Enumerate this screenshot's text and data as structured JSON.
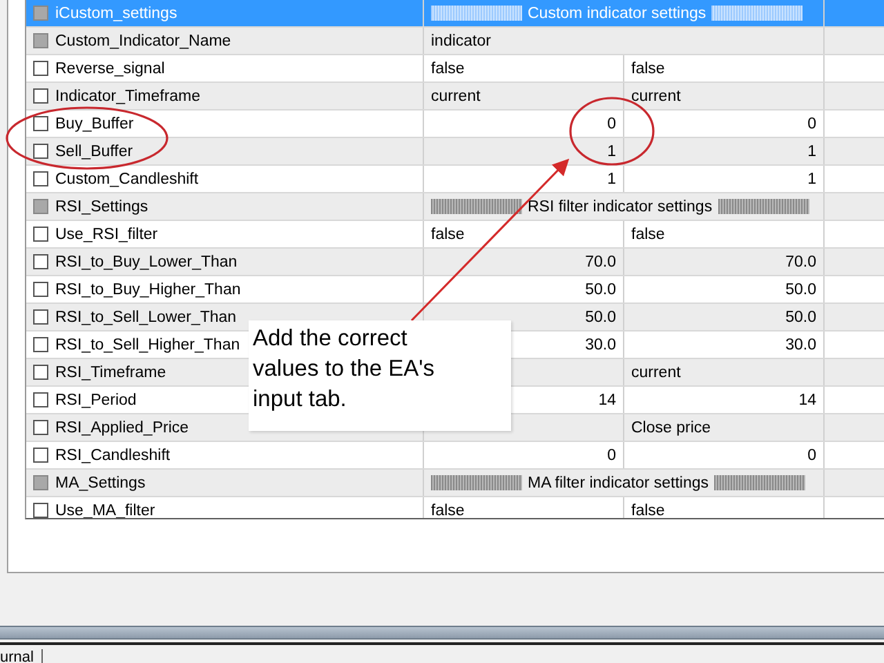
{
  "inputs": {
    "rows": [
      {
        "kind": "group",
        "name": "iCustom_settings",
        "value": "Custom indicator settings",
        "disabled": true,
        "selected": true
      },
      {
        "kind": "string",
        "name": "Custom_Indicator_Name",
        "value": "indicator",
        "disabled": true,
        "selected": false
      },
      {
        "kind": "text",
        "name": "Reverse_signal",
        "value": "false",
        "start": "false",
        "disabled": false,
        "selected": false
      },
      {
        "kind": "text",
        "name": "Indicator_Timeframe",
        "value": "current",
        "start": "current",
        "disabled": false,
        "selected": false
      },
      {
        "kind": "number",
        "name": "Buy_Buffer",
        "value": "0",
        "start": "0",
        "disabled": false,
        "selected": false
      },
      {
        "kind": "number",
        "name": "Sell_Buffer",
        "value": "1",
        "start": "1",
        "disabled": false,
        "selected": false
      },
      {
        "kind": "number",
        "name": "Custom_Candleshift",
        "value": "1",
        "start": "1",
        "disabled": false,
        "selected": false
      },
      {
        "kind": "group",
        "name": "RSI_Settings",
        "value": "RSI filter indicator settings",
        "disabled": true,
        "selected": false
      },
      {
        "kind": "text",
        "name": "Use_RSI_filter",
        "value": "false",
        "start": "false",
        "disabled": false,
        "selected": false
      },
      {
        "kind": "number",
        "name": "RSI_to_Buy_Lower_Than",
        "value": "70.0",
        "start": "70.0",
        "disabled": false,
        "selected": false
      },
      {
        "kind": "number",
        "name": "RSI_to_Buy_Higher_Than",
        "value": "50.0",
        "start": "50.0",
        "disabled": false,
        "selected": false
      },
      {
        "kind": "number",
        "name": "RSI_to_Sell_Lower_Than",
        "value": "50.0",
        "start": "50.0",
        "disabled": false,
        "selected": false
      },
      {
        "kind": "number",
        "name": "RSI_to_Sell_Higher_Than",
        "value": "30.0",
        "start": "30.0",
        "disabled": false,
        "selected": false
      },
      {
        "kind": "text",
        "name": "RSI_Timeframe",
        "start": "current",
        "disabled": false,
        "selected": false
      },
      {
        "kind": "number",
        "name": "RSI_Period",
        "value": "14",
        "start": "14",
        "disabled": false,
        "selected": false
      },
      {
        "kind": "text",
        "name": "RSI_Applied_Price",
        "start": "Close price",
        "disabled": false,
        "selected": false
      },
      {
        "kind": "number",
        "name": "RSI_Candleshift",
        "value": "0",
        "start": "0",
        "disabled": false,
        "selected": false
      },
      {
        "kind": "group",
        "name": "MA_Settings",
        "value": "MA filter indicator settings",
        "disabled": true,
        "selected": false
      },
      {
        "kind": "text",
        "name": "Use_MA_filter",
        "value": "false",
        "start": "false",
        "disabled": false,
        "selected": false
      }
    ]
  },
  "callout": {
    "text": "Add the correct values to the EA's input tab."
  },
  "bottom_tabs": [
    {
      "label": "urnal"
    }
  ]
}
